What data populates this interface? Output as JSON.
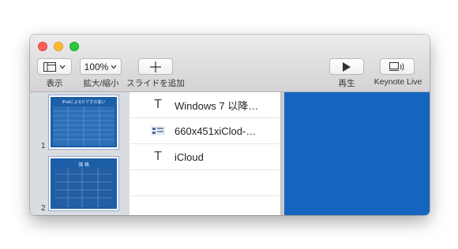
{
  "toolbar": {
    "view_label": "表示",
    "zoom_value": "100%",
    "zoom_label": "拡大/縮小",
    "add_slide_label": "スライドを追加",
    "play_label": "再生",
    "keynote_live_label": "Keynote Live"
  },
  "slides": [
    {
      "number": "1",
      "title": "iPadによるビデオの違い"
    },
    {
      "number": "2",
      "title": "価 格"
    }
  ],
  "outline": [
    {
      "icon": "text-icon",
      "text": "Windows 7 以降…"
    },
    {
      "icon": "image-icon",
      "text": "660x451xiClod-…"
    },
    {
      "icon": "text-icon",
      "text": "iCloud"
    }
  ],
  "colors": {
    "canvas": "#1565c0",
    "thumb": "#1b5fa8"
  }
}
